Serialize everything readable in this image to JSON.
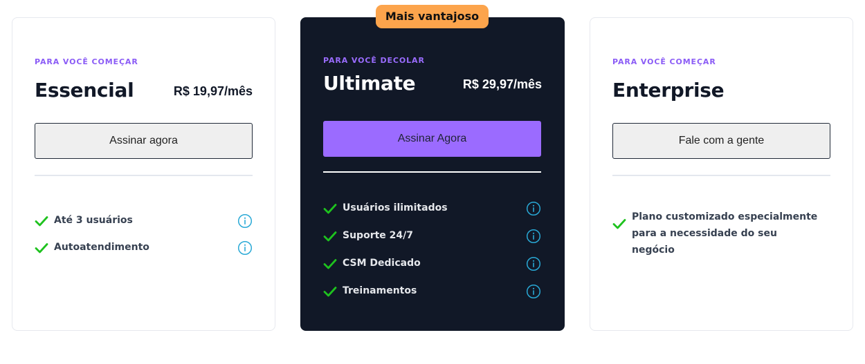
{
  "highlight_badge": "Mais vantajoso",
  "colors": {
    "accent_purple": "#9b6bff",
    "badge_orange": "#fca44c",
    "dark_card": "#111827",
    "check_green": "#1ec21e",
    "info_cyan": "#29a9d6"
  },
  "plans": [
    {
      "tier": "PARA VOCÊ COMEÇAR",
      "name": "Essencial",
      "price": "R$ 19,97/mês",
      "cta": "Assinar agora",
      "features": [
        {
          "label": "Até 3 usuários",
          "icon": "info-icon"
        },
        {
          "label": "Autoatendimento",
          "icon": "info-icon"
        }
      ]
    },
    {
      "tier": "PARA VOCÊ DECOLAR",
      "name": "Ultimate",
      "price": "R$ 29,97/mês",
      "cta": "Assinar Agora",
      "features": [
        {
          "label": "Usuários ilimitados",
          "icon": "info-icon"
        },
        {
          "label": "Suporte 24/7",
          "icon": "info-icon"
        },
        {
          "label": "CSM Dedicado",
          "icon": "info-icon"
        },
        {
          "label": "Treinamentos",
          "icon": "info-icon"
        }
      ]
    },
    {
      "tier": "PARA VOCÊ COMEÇAR",
      "name": "Enterprise",
      "price": "",
      "cta": "Fale com a gente",
      "features": [
        {
          "label": "Plano customizado especialmente para a necessidade do seu negócio",
          "icon": "check-icon"
        }
      ]
    }
  ]
}
